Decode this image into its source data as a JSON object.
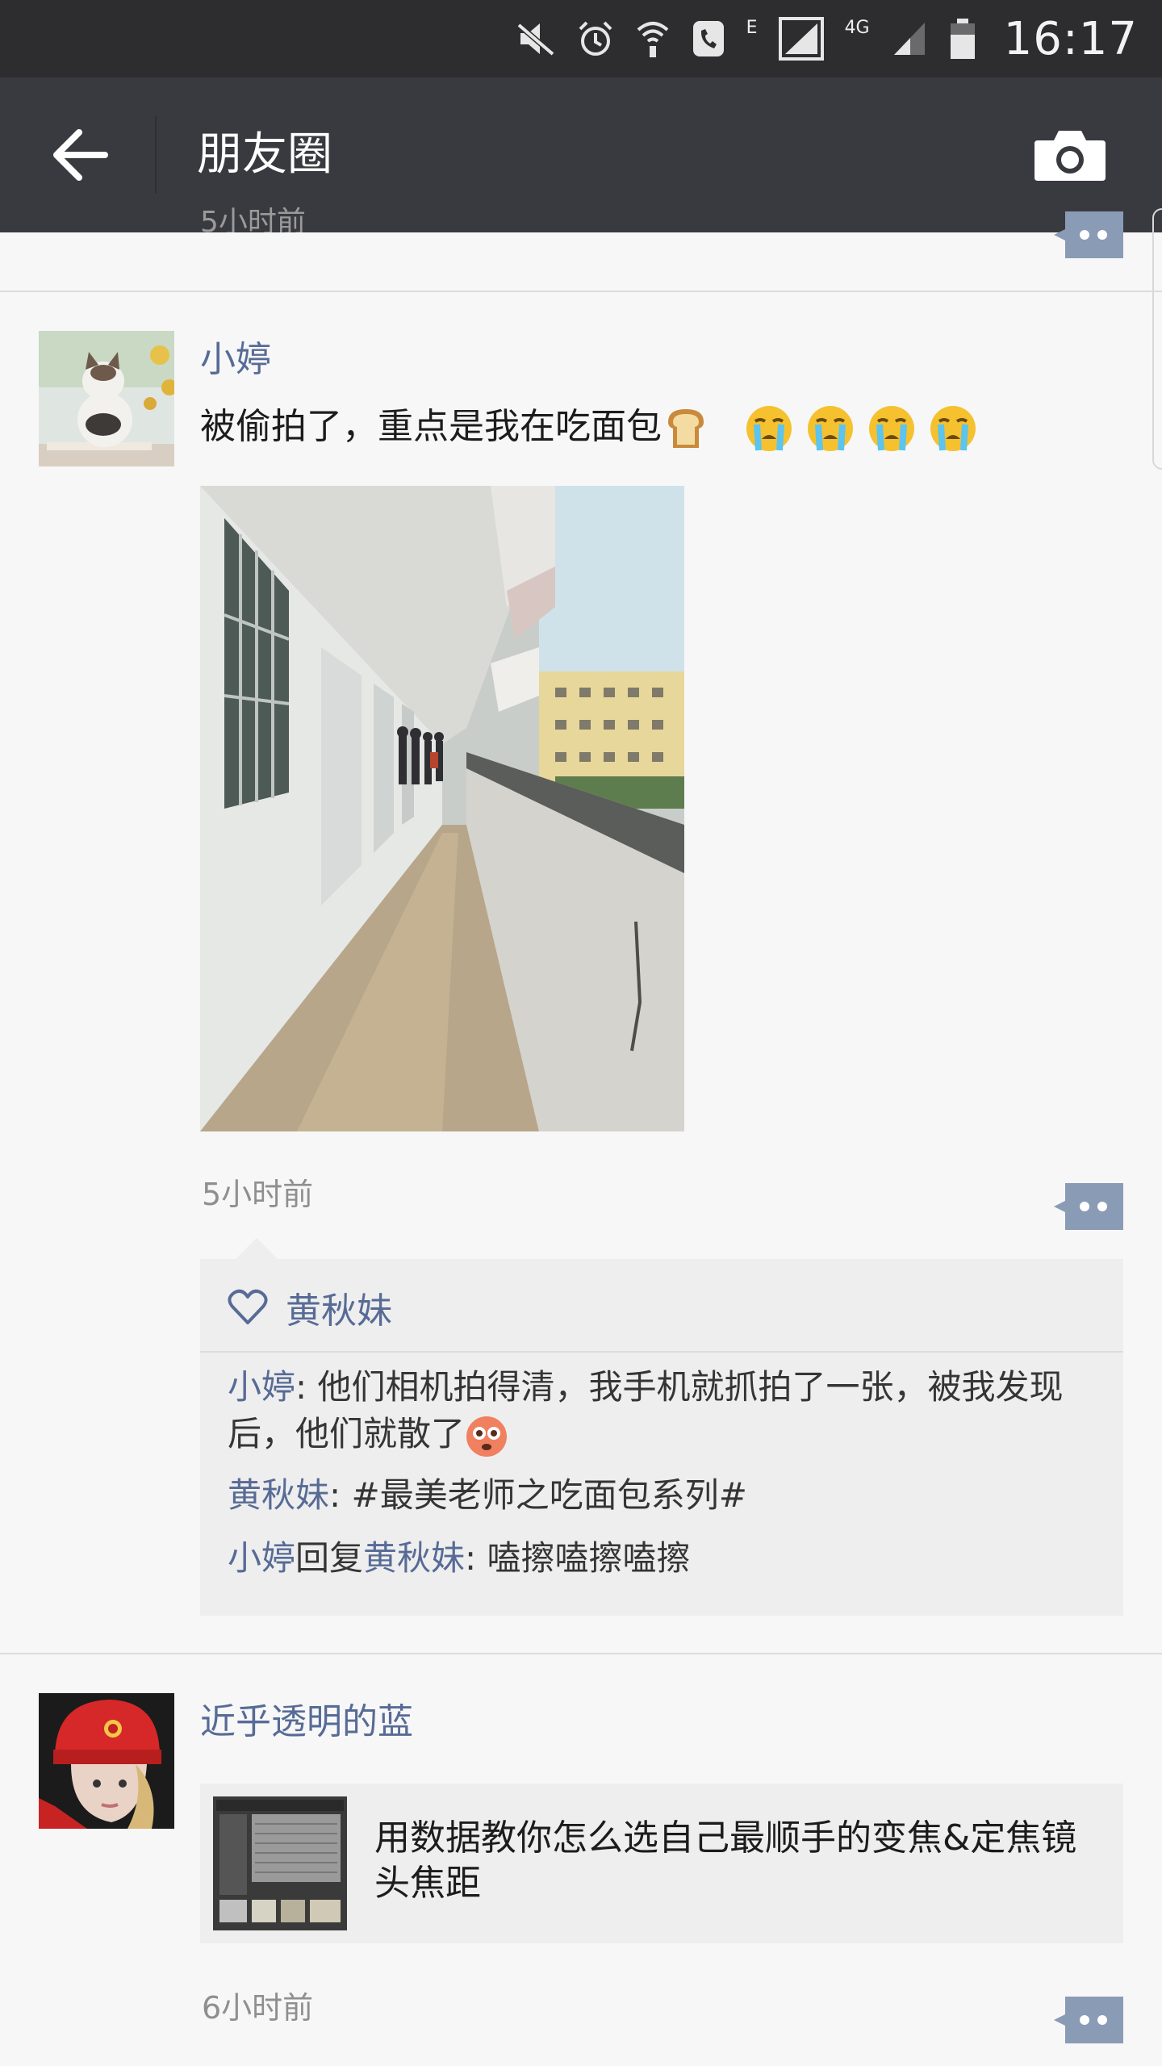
{
  "status": {
    "net_label_e": "E",
    "net_label_4g": "4G",
    "time": "16:17"
  },
  "header": {
    "title": "朋友圈"
  },
  "previous_post": {
    "time_fragment": "5小时前"
  },
  "post1": {
    "author": "小婷",
    "text": "被偷拍了，重点是我在吃面包",
    "emojis": [
      "bread-emoji",
      "crying-emoji",
      "crying-emoji",
      "crying-emoji",
      "crying-emoji"
    ],
    "time": "5小时前",
    "liker": "黄秋妹",
    "comments": [
      {
        "from": "小婷",
        "text": ": 他们相机拍得清，我手机就抓拍了一张，被我发现后，他们就散了"
      },
      {
        "from": "黄秋妹",
        "text": ": #最美老师之吃面包系列#"
      },
      {
        "from": "小婷",
        "reply_word": "回复",
        "to": "黄秋妹",
        "text": ": 嗑擦嗑擦嗑擦"
      }
    ]
  },
  "post2": {
    "author": "近乎透明的蓝",
    "link_title": "用数据教你怎么选自己最顺手的变焦&定焦镜头焦距",
    "time": "6小时前"
  },
  "colors": {
    "statusbar_bg": "#2d2d2f",
    "titlebar_bg": "#393a3f",
    "page_bg": "#f7f7f8",
    "name_blue": "#576b95",
    "panel_bg": "#eeeeef",
    "comment_btn": "#8a9bb5"
  }
}
